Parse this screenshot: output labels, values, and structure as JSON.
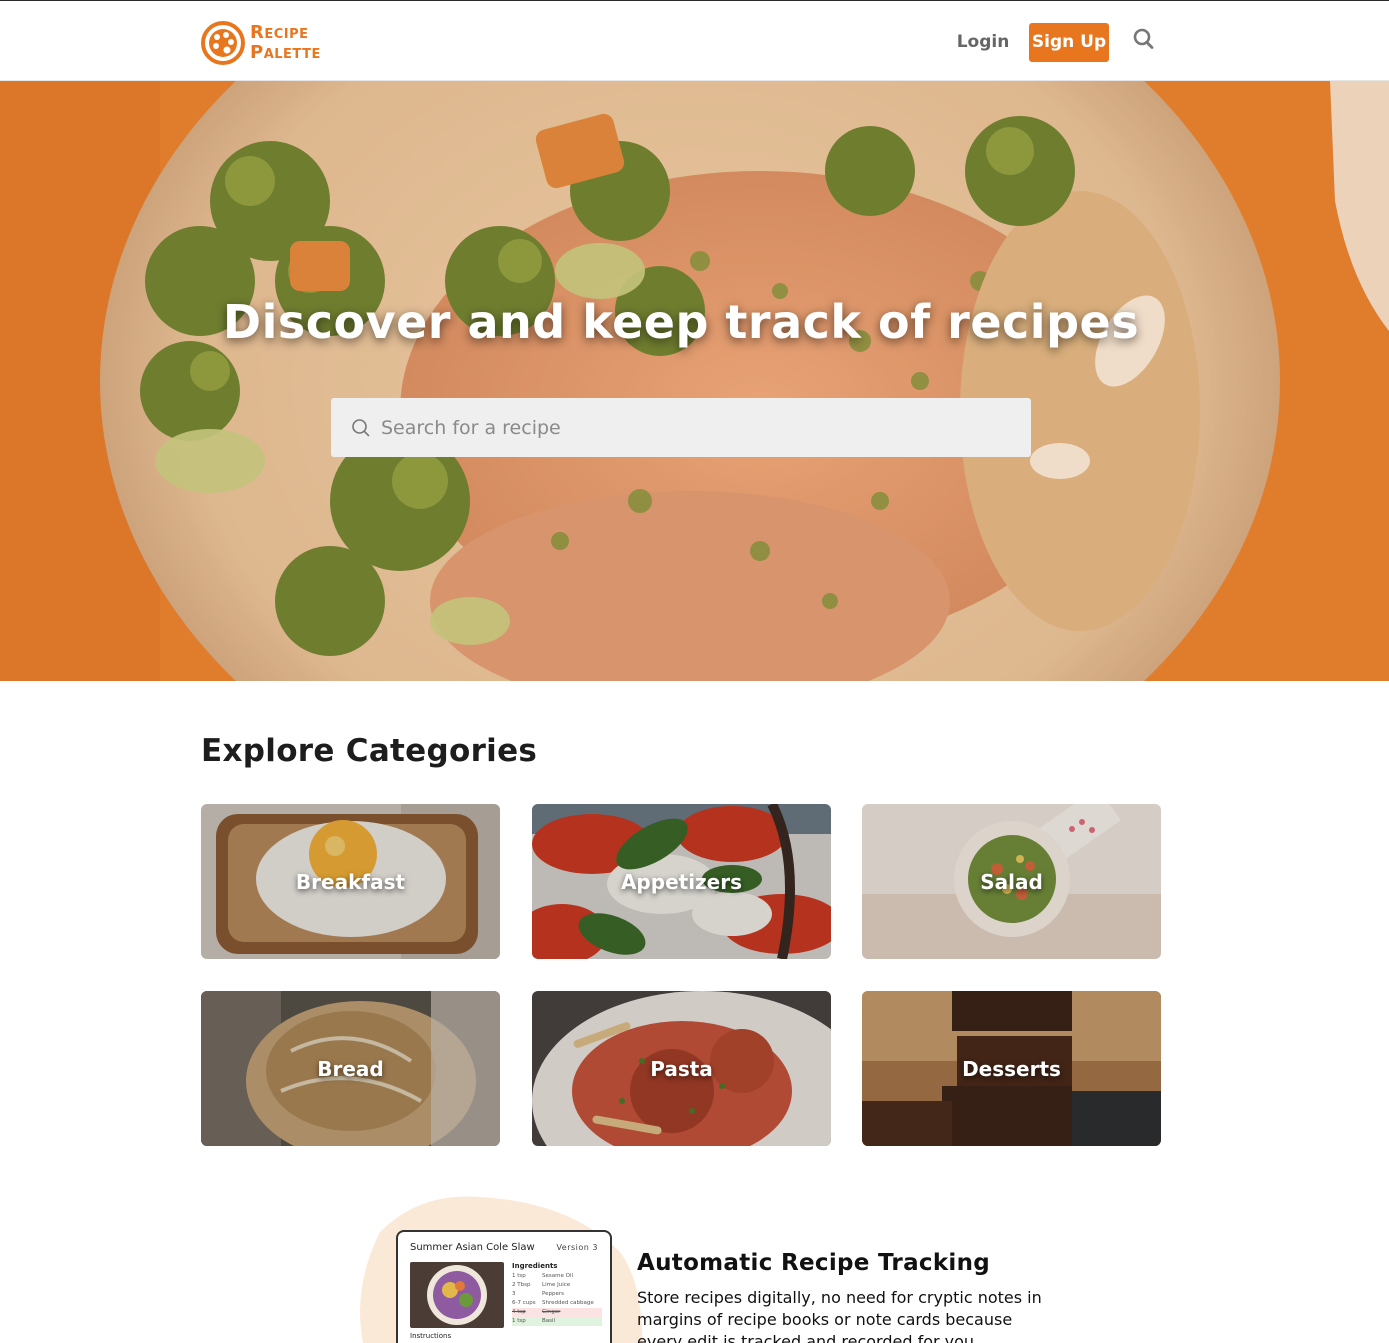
{
  "header": {
    "logo_line1": "Recipe",
    "logo_line2": "Palette",
    "login_label": "Login",
    "signup_label": "Sign Up",
    "search_icon": "search-icon"
  },
  "hero": {
    "title": "Discover and keep track of recipes",
    "search_placeholder": "Search for a recipe",
    "search_icon": "search-icon"
  },
  "categories": {
    "heading": "Explore Categories",
    "items": [
      {
        "label": "Breakfast"
      },
      {
        "label": "Appetizers"
      },
      {
        "label": "Salad"
      },
      {
        "label": "Bread"
      },
      {
        "label": "Pasta"
      },
      {
        "label": "Desserts"
      }
    ]
  },
  "feature": {
    "title": "Automatic Recipe Tracking",
    "text": "Store recipes digitally, no need for cryptic notes in margins of recipe books or note cards because every edit is tracked and recorded for you.",
    "preview": {
      "recipe_title": "Summer Asian Cole Slaw",
      "version": "Version 3",
      "ingredients_label": "Ingredients",
      "instructions_label": "Instructions",
      "rows": [
        {
          "qty": "1 tsp",
          "item": "Sesame Oil"
        },
        {
          "qty": "2 Tbsp",
          "item": "Lime Juice"
        },
        {
          "qty": "3",
          "item": "Peppers"
        },
        {
          "qty": "6-7 cups",
          "item": "Shredded cabbage"
        },
        {
          "qty": "4 tsp",
          "item": "Ginger"
        },
        {
          "qty": "1 tsp",
          "item": "Basil"
        }
      ]
    }
  },
  "colors": {
    "accent": "#e8761f",
    "hero_orange": "#e07a2a"
  }
}
